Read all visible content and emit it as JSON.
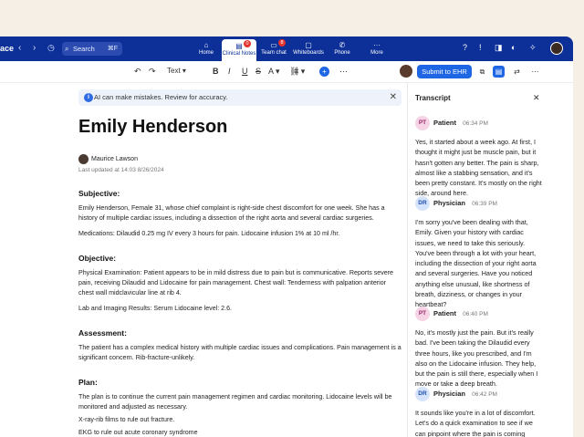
{
  "topbar": {
    "brand": "ace",
    "search_label": "Search",
    "search_shortcut": "⌘F",
    "tabs": [
      {
        "label": "Home",
        "icon": "home-icon",
        "badge": ""
      },
      {
        "label": "Clinical Notes",
        "icon": "notes-icon",
        "badge": "0"
      },
      {
        "label": "Team chat",
        "icon": "chat-icon",
        "badge": "8"
      },
      {
        "label": "Whiteboards",
        "icon": "whiteboard-icon",
        "badge": ""
      },
      {
        "label": "Phone",
        "icon": "phone-icon",
        "badge": ""
      },
      {
        "label": "More",
        "icon": "more-icon",
        "badge": ""
      }
    ]
  },
  "toolbar": {
    "text_style": "Text",
    "submit_label": "Submit to EHR"
  },
  "notice": {
    "text": "AI can make mistakes. Review for accuracy."
  },
  "document": {
    "title": "Emily Henderson",
    "author": "Maurice Lawson",
    "updated": "Last updated at 14:03 8/26/2024",
    "sections": [
      {
        "heading": "Subjective:",
        "paragraphs": [
          "Emily Henderson, Female 31, whose chief complaint is right-side chest discomfort for one week. She has a history of multiple cardiac issues, including a dissection of the right aorta and several cardiac surgeries.",
          "Medications: Dilaudid 0.25 mg IV every 3 hours for pain. Lidocaine infusion 1% at 10 ml /hr."
        ]
      },
      {
        "heading": "Objective:",
        "paragraphs": [
          "Physical Examination: Patient appears to be in mild distress due to pain but is communicative. Reports severe pain, receiving Dilaudid and Lidocaine for pain management. Chest wall: Tenderness with palpation anterior chest wall midclavicular line at rib 4.",
          "Lab and Imaging Results: Serum Lidocaine level: 2.6."
        ]
      },
      {
        "heading": "Assessment:",
        "paragraphs": [
          "The patient has a complex medical history with multiple cardiac issues and complications. Pain management is a significant concern. Rib-fracture-unlikely."
        ]
      },
      {
        "heading": "Plan:",
        "paragraphs": [
          "The plan is to continue the current pain management regimen and cardiac monitoring. Lidocaine levels will be monitored and adjusted as necessary.",
          "X-ray-rib films to rule out fracture.",
          "EKG to rule out acute coronary syndrome"
        ]
      }
    ]
  },
  "transcript": {
    "title": "Transcript",
    "messages": [
      {
        "initials": "PT",
        "speaker": "Patient",
        "time": "06:34 PM",
        "text": "Yes, it started about a week ago. At first, I thought it might just be muscle pain, but it hasn't gotten any better. The pain is sharp, almost like a stabbing sensation, and it's been pretty constant. It's mostly on the right side, around here."
      },
      {
        "initials": "DR",
        "speaker": "Physician",
        "time": "06:39 PM",
        "text": "I'm sorry you've been dealing with that, Emily. Given your history with cardiac issues, we need to take this seriously. You've been through a lot with your heart, including the dissection of your right aorta and several surgeries. Have you noticed anything else unusual, like shortness of breath, dizziness, or changes in your heartbeat?"
      },
      {
        "initials": "PT",
        "speaker": "Patient",
        "time": "06:40 PM",
        "text": "No, it's mostly just the pain. But it's really bad. I've been taking the Dilaudid every three hours, like you prescribed, and I'm also on the Lidocaine infusion. They help, but the pain is still there, especially when I move or take a deep breath."
      },
      {
        "initials": "DR",
        "speaker": "Physician",
        "time": "06:42 PM",
        "text": "It sounds like you're in a lot of discomfort. Let's do a quick examination to see if we can pinpoint where the pain is coming"
      }
    ]
  },
  "colors": {
    "topbar": "#0c2f98",
    "accent": "#1f66e5",
    "patient_badge": "#f6d4e6",
    "physician_badge": "#d6e4fb"
  }
}
